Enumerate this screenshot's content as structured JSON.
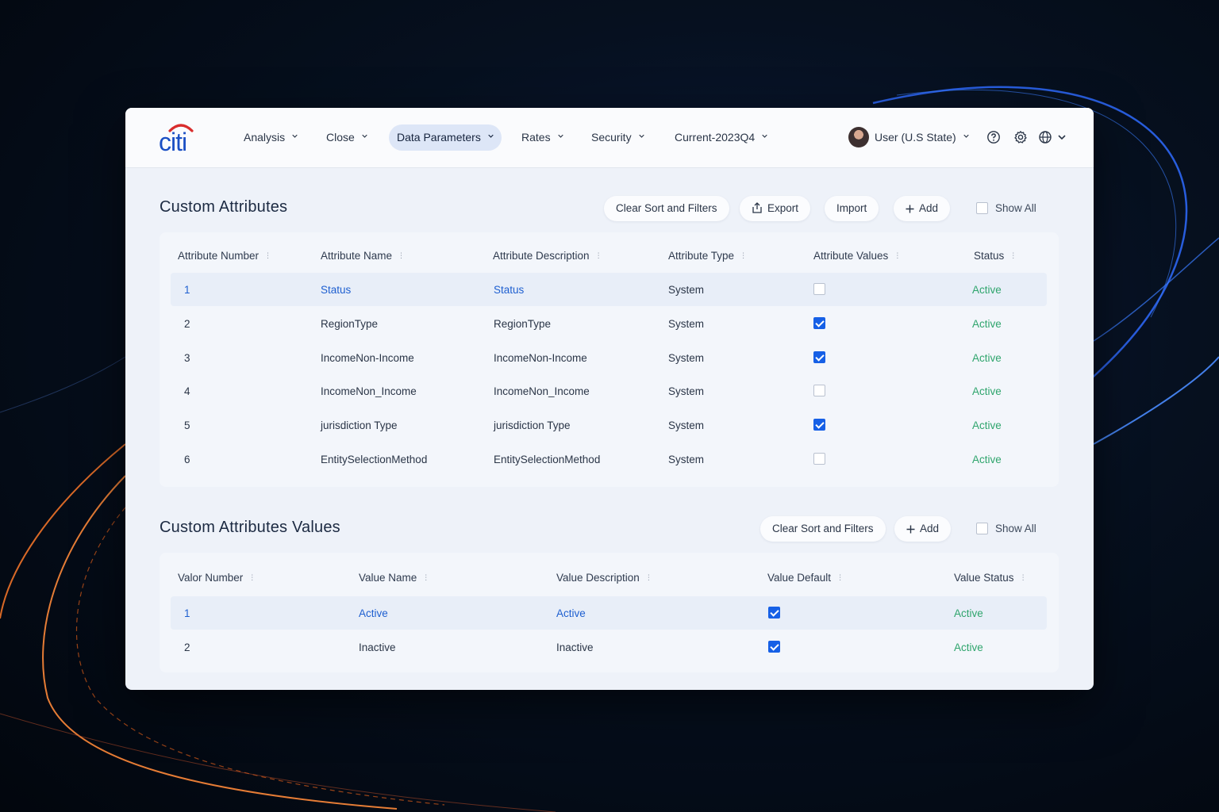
{
  "brand": {
    "logo_text": "citi",
    "logo_color": "#1a4fc4",
    "arc_color": "#d92d2d"
  },
  "nav": {
    "items": [
      {
        "label": "Analysis"
      },
      {
        "label": "Close"
      },
      {
        "label": "Data Parameters",
        "active": true
      },
      {
        "label": "Rates"
      },
      {
        "label": "Security"
      },
      {
        "label": "Current-2023Q4"
      }
    ],
    "user_label": "User (U.S State)",
    "icons": [
      "help-icon",
      "settings-icon",
      "globe-icon"
    ]
  },
  "attributes": {
    "title": "Custom Attributes",
    "buttons": {
      "clear": "Clear Sort and Filters",
      "export": "Export",
      "import": "Import",
      "add": "Add",
      "show_all": "Show All"
    },
    "columns": [
      "Attribute Number",
      "Attribute Name",
      "Attribute Description",
      "Attribute Type",
      "Attribute Values",
      "Status"
    ],
    "rows": [
      {
        "number": "1",
        "name": "Status",
        "description": "Status",
        "type": "System",
        "values_checked": false,
        "status": "Active"
      },
      {
        "number": "2",
        "name": "RegionType",
        "description": "RegionType",
        "type": "System",
        "values_checked": true,
        "status": "Active"
      },
      {
        "number": "3",
        "name": "IncomeNon-Income",
        "description": "IncomeNon-Income",
        "type": "System",
        "values_checked": true,
        "status": "Active"
      },
      {
        "number": "4",
        "name": "IncomeNon_Income",
        "description": "IncomeNon_Income",
        "type": "System",
        "values_checked": false,
        "status": "Active"
      },
      {
        "number": "5",
        "name": "jurisdiction Type",
        "description": "jurisdiction Type",
        "type": "System",
        "values_checked": true,
        "status": "Active"
      },
      {
        "number": "6",
        "name": "EntitySelectionMethod",
        "description": "EntitySelectionMethod",
        "type": "System",
        "values_checked": false,
        "status": "Active"
      }
    ]
  },
  "values": {
    "title": "Custom Attributes Values",
    "buttons": {
      "clear": "Clear Sort and Filters",
      "add": "Add",
      "show_all": "Show All"
    },
    "columns": [
      "Valor Number",
      "Value Name",
      "Value Description",
      "Value Default",
      "Value Status"
    ],
    "rows": [
      {
        "number": "1",
        "name": "Active",
        "description": "Active",
        "default_checked": true,
        "status": "Active"
      },
      {
        "number": "2",
        "name": "Inactive",
        "description": "Inactive",
        "default_checked": true,
        "status": "Active"
      }
    ]
  },
  "colors": {
    "accent": "#1660e6",
    "status_active": "#2fa56d",
    "link": "#1e5fd0"
  }
}
